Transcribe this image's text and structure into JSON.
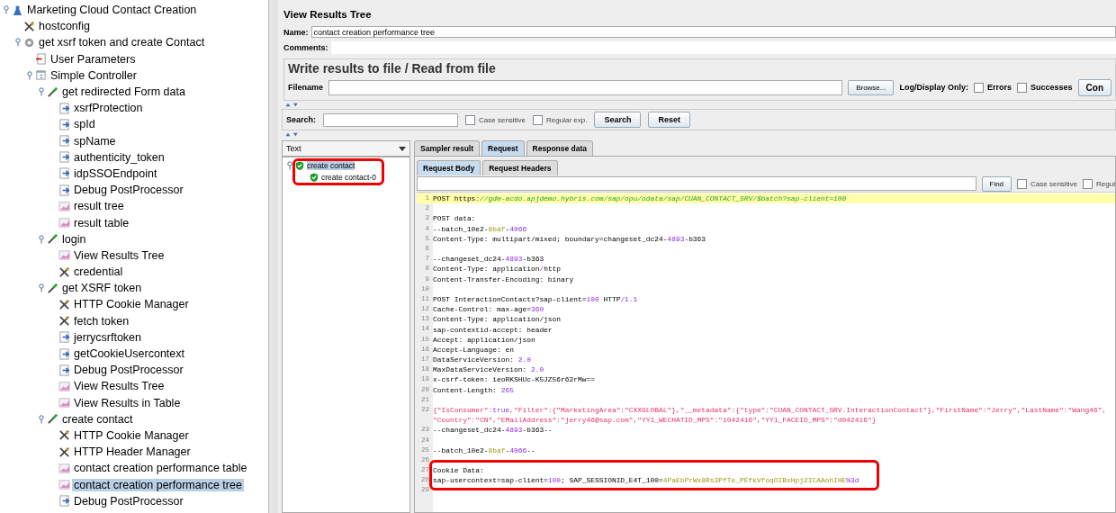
{
  "tree": [
    {
      "label": "Marketing Cloud Contact Creation",
      "kind": "plan",
      "expanded": true,
      "selected": false,
      "children": [
        {
          "label": "hostconfig",
          "kind": "config",
          "selected": false
        },
        {
          "label": "get xsrf token and create Contact",
          "kind": "thread",
          "expanded": true,
          "selected": false,
          "children": [
            {
              "label": "User Parameters",
              "kind": "preprocessor",
              "selected": false
            },
            {
              "label": "Simple Controller",
              "kind": "controller",
              "expanded": true,
              "selected": false,
              "children": [
                {
                  "label": "get redirected Form data",
                  "kind": "sampler",
                  "expanded": true,
                  "selected": false,
                  "children": [
                    {
                      "label": "xsrfProtection",
                      "kind": "extractor",
                      "selected": false
                    },
                    {
                      "label": "spId",
                      "kind": "extractor",
                      "selected": false
                    },
                    {
                      "label": "spName",
                      "kind": "extractor",
                      "selected": false
                    },
                    {
                      "label": "authenticity_token",
                      "kind": "extractor",
                      "selected": false
                    },
                    {
                      "label": "idpSSOEndpoint",
                      "kind": "extractor",
                      "selected": false
                    },
                    {
                      "label": "Debug PostProcessor",
                      "kind": "extractor",
                      "selected": false
                    },
                    {
                      "label": "result tree",
                      "kind": "listener",
                      "selected": false
                    },
                    {
                      "label": "result table",
                      "kind": "listener",
                      "selected": false
                    }
                  ]
                },
                {
                  "label": "login",
                  "kind": "sampler",
                  "expanded": true,
                  "selected": false,
                  "children": [
                    {
                      "label": "View Results Tree",
                      "kind": "listener",
                      "selected": false
                    },
                    {
                      "label": "credential",
                      "kind": "config",
                      "selected": false
                    }
                  ]
                },
                {
                  "label": "get XSRF token",
                  "kind": "sampler",
                  "expanded": true,
                  "selected": false,
                  "children": [
                    {
                      "label": "HTTP Cookie Manager",
                      "kind": "config",
                      "selected": false
                    },
                    {
                      "label": "fetch token",
                      "kind": "config",
                      "selected": false
                    },
                    {
                      "label": "jerrycsrftoken",
                      "kind": "extractor",
                      "selected": false
                    },
                    {
                      "label": "getCookieUsercontext",
                      "kind": "extractor",
                      "selected": false
                    },
                    {
                      "label": "Debug PostProcessor",
                      "kind": "extractor",
                      "selected": false
                    },
                    {
                      "label": "View Results Tree",
                      "kind": "listener",
                      "selected": false
                    },
                    {
                      "label": "View Results in Table",
                      "kind": "listener",
                      "selected": false
                    }
                  ]
                },
                {
                  "label": "create contact",
                  "kind": "sampler",
                  "expanded": true,
                  "selected": false,
                  "children": [
                    {
                      "label": "HTTP Cookie Manager",
                      "kind": "config",
                      "selected": false
                    },
                    {
                      "label": "HTTP Header Manager",
                      "kind": "config",
                      "selected": false
                    },
                    {
                      "label": "contact creation performance table",
                      "kind": "listener",
                      "selected": false
                    },
                    {
                      "label": "contact creation performance tree",
                      "kind": "listener",
                      "selected": true
                    },
                    {
                      "label": "Debug PostProcessor",
                      "kind": "extractor",
                      "selected": false
                    }
                  ]
                }
              ]
            }
          ]
        }
      ]
    }
  ],
  "panel": {
    "title": "View Results Tree",
    "name_label": "Name:",
    "name_value": "contact creation performance tree",
    "comments_label": "Comments:",
    "file_group": {
      "title": "Write results to file / Read from file",
      "filename_label": "Filename",
      "browse": "Browse...",
      "log_label": "Log/Display Only:",
      "options": [
        {
          "label": "Errors",
          "checked": false
        },
        {
          "label": "Successes",
          "checked": false
        }
      ],
      "button_cut": "Con"
    },
    "search": {
      "label": "Search:",
      "options": [
        {
          "label": "Case sensitive",
          "checked": false
        },
        {
          "label": "Regular exp.",
          "checked": false
        }
      ],
      "buttons": [
        "Search",
        "Reset"
      ]
    },
    "renderer": "Text",
    "results": [
      {
        "label": "create contact",
        "success": true,
        "expanded": true,
        "selected": true,
        "children": [
          {
            "label": "create contact-0",
            "success": true,
            "selected": false
          }
        ]
      }
    ],
    "tabs": [
      {
        "label": "Sampler result",
        "selected": false
      },
      {
        "label": "Request",
        "selected": true
      },
      {
        "label": "Response data",
        "selected": false
      }
    ],
    "subtabs": [
      {
        "label": "Request Body",
        "selected": true
      },
      {
        "label": "Request Headers",
        "selected": false
      }
    ],
    "find": {
      "button": "Find",
      "options": [
        {
          "label": "Case sensitive",
          "checked": false
        },
        {
          "label": "Regul",
          "checked": false
        }
      ]
    },
    "code": [
      {
        "number": "1",
        "current": true,
        "segments": [
          {
            "text": "POST https",
            "kind": "plain"
          },
          {
            "text": "://gdm-acdo.apjdemo.hybris.com/sap/opu/odata/sap/CUAN_CONTACT_SRV/$batch?sap-client=100",
            "kind": "url"
          }
        ]
      },
      {
        "number": "2",
        "current": false
      },
      {
        "number": "3",
        "current": false,
        "segments": [
          {
            "text": "POST data:",
            "kind": "plain"
          }
        ]
      },
      {
        "number": "4",
        "current": false,
        "segments": [
          {
            "text": "--batch_10e2-",
            "kind": "plain"
          },
          {
            "text": "8baf",
            "kind": "hex"
          },
          {
            "text": "-",
            "kind": "plain"
          },
          {
            "text": "4066",
            "kind": "num"
          }
        ]
      },
      {
        "number": "5",
        "current": false,
        "segments": [
          {
            "text": "Content-Type: multipart/mixed; boundary=changeset_dc24-",
            "kind": "plain"
          },
          {
            "text": "4893",
            "kind": "num"
          },
          {
            "text": "-b363",
            "kind": "plain"
          }
        ]
      },
      {
        "number": "6",
        "current": false
      },
      {
        "number": "7",
        "current": false,
        "segments": [
          {
            "text": "--changeset_dc24-",
            "kind": "plain"
          },
          {
            "text": "4893",
            "kind": "num"
          },
          {
            "text": "-b363",
            "kind": "plain"
          }
        ]
      },
      {
        "number": "8",
        "current": false,
        "segments": [
          {
            "text": "Content-Type: application",
            "kind": "plain"
          },
          {
            "text": "/",
            "kind": "num"
          },
          {
            "text": "http",
            "kind": "plain"
          }
        ]
      },
      {
        "number": "9",
        "current": false,
        "segments": [
          {
            "text": "Content-Transfer-Encoding: binary",
            "kind": "plain"
          }
        ]
      },
      {
        "number": "10",
        "current": false
      },
      {
        "number": "11",
        "current": false,
        "segments": [
          {
            "text": "POST InteractionContacts?sap-client=",
            "kind": "plain"
          },
          {
            "text": "100",
            "kind": "num"
          },
          {
            "text": " HTTP",
            "kind": "plain"
          },
          {
            "text": "/1.1",
            "kind": "num"
          }
        ]
      },
      {
        "number": "12",
        "current": false,
        "segments": [
          {
            "text": "Cache-Control: max-age=",
            "kind": "plain"
          },
          {
            "text": "360",
            "kind": "num"
          }
        ]
      },
      {
        "number": "13",
        "current": false,
        "segments": [
          {
            "text": "Content-Type: application/json",
            "kind": "plain"
          }
        ]
      },
      {
        "number": "14",
        "current": false,
        "segments": [
          {
            "text": "sap-contextid-accept: header",
            "kind": "plain"
          }
        ]
      },
      {
        "number": "15",
        "current": false,
        "segments": [
          {
            "text": "Accept: application/json",
            "kind": "plain"
          }
        ]
      },
      {
        "number": "16",
        "current": false,
        "segments": [
          {
            "text": "Accept-Language: en",
            "kind": "plain"
          }
        ]
      },
      {
        "number": "17",
        "current": false,
        "segments": [
          {
            "text": "DataServiceVersion: ",
            "kind": "plain"
          },
          {
            "text": "2.0",
            "kind": "num"
          }
        ]
      },
      {
        "number": "18",
        "current": false,
        "segments": [
          {
            "text": "MaxDataServiceVersion: ",
            "kind": "plain"
          },
          {
            "text": "2.0",
            "kind": "num"
          }
        ]
      },
      {
        "number": "19",
        "current": false,
        "segments": [
          {
            "text": "x-csrf-token: ieoRKSHUc-K5JZ56r62rMw==",
            "kind": "plain"
          }
        ]
      },
      {
        "number": "20",
        "current": false,
        "segments": [
          {
            "text": "Content-Length: ",
            "kind": "plain"
          },
          {
            "text": "265",
            "kind": "num"
          }
        ]
      },
      {
        "number": "21",
        "current": false
      },
      {
        "number": "22",
        "current": false,
        "segments": [
          {
            "text": "{\"IsConsumer\":",
            "kind": "str"
          },
          {
            "text": "true",
            "kind": "num"
          },
          {
            "text": ",\"Filter\":{\"MarketingArea\":\"CXXGLOBAL\"},\"__metadata\":{\"type\":\"CUAN_CONTACT_SRV.InteractionContact\"},\"FirstName\":\"Jerry\",\"LastName\":\"Wang46\",",
            "kind": "str"
          }
        ],
        "continued": [
          {
            "text": "\"Country\":\"CN\",\"EMailAddress\":\"jerry46@sap.com\",\"YY1_WECHATID_MPS\":\"i042416\",\"YY1_FACEID_MPS\":\"d042416\"}",
            "kind": "str"
          }
        ]
      },
      {
        "number": "23",
        "current": false,
        "segments": [
          {
            "text": "--changeset_dc24-",
            "kind": "plain"
          },
          {
            "text": "4893",
            "kind": "num"
          },
          {
            "text": "-b363--",
            "kind": "plain"
          }
        ]
      },
      {
        "number": "24",
        "current": false
      },
      {
        "number": "25",
        "current": false,
        "segments": [
          {
            "text": "--batch_10e2-",
            "kind": "plain"
          },
          {
            "text": "8baf",
            "kind": "hex"
          },
          {
            "text": "-",
            "kind": "plain"
          },
          {
            "text": "4066",
            "kind": "num"
          },
          {
            "text": "--",
            "kind": "plain"
          }
        ]
      },
      {
        "number": "26",
        "current": false
      },
      {
        "number": "27",
        "current": false,
        "segments": [
          {
            "text": "Cookie Data:",
            "kind": "plain"
          }
        ]
      },
      {
        "number": "28",
        "current": false,
        "segments": [
          {
            "text": "sap-usercontext=sap-client=",
            "kind": "plain"
          },
          {
            "text": "100",
            "kind": "num"
          },
          {
            "text": "; SAP_SESSIONID_E4T_100=",
            "kind": "plain"
          },
          {
            "text": "4PaEbPrWx8Rs3PfTe_PEfkVfoqOIBxHpj2ICAAohIHE",
            "kind": "hex"
          },
          {
            "text": "%3d",
            "kind": "num"
          }
        ]
      },
      {
        "number": "29",
        "current": false
      }
    ]
  }
}
